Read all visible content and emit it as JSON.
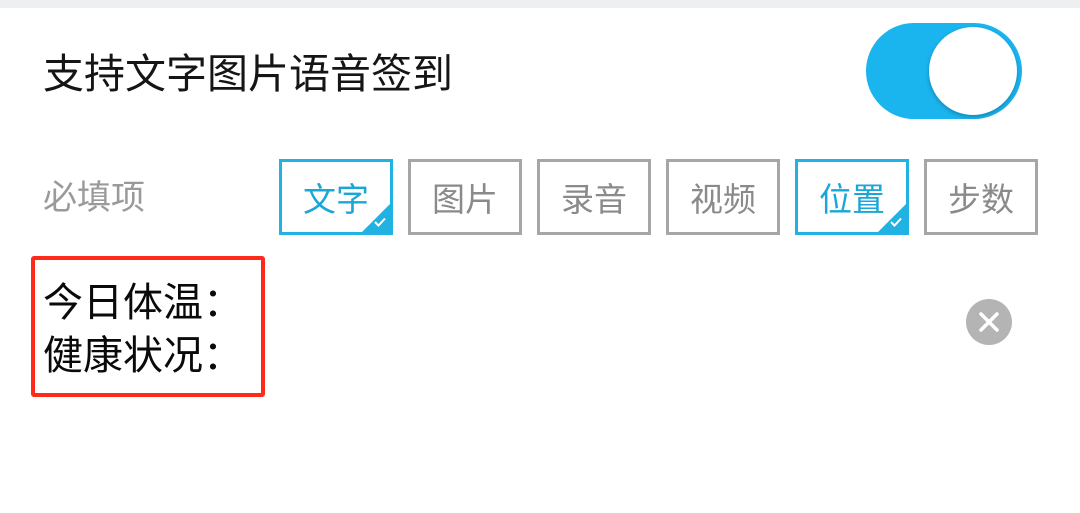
{
  "setting": {
    "title": "支持文字图片语音签到",
    "toggle_on": true
  },
  "required": {
    "label": "必填项",
    "options": [
      {
        "label": "文字",
        "selected": true
      },
      {
        "label": "图片",
        "selected": false
      },
      {
        "label": "录音",
        "selected": false
      },
      {
        "label": "视频",
        "selected": false
      },
      {
        "label": "位置",
        "selected": true
      },
      {
        "label": "步数",
        "selected": false
      }
    ]
  },
  "note": {
    "lines": [
      "今日体温：",
      "健康状况："
    ]
  },
  "icons": {
    "clear": "close-circle-icon",
    "check": "checkmark-icon"
  },
  "colors": {
    "accent": "#1ab4ef",
    "highlight_box": "#ff2a1a",
    "unselected": "#a6a6a6"
  }
}
